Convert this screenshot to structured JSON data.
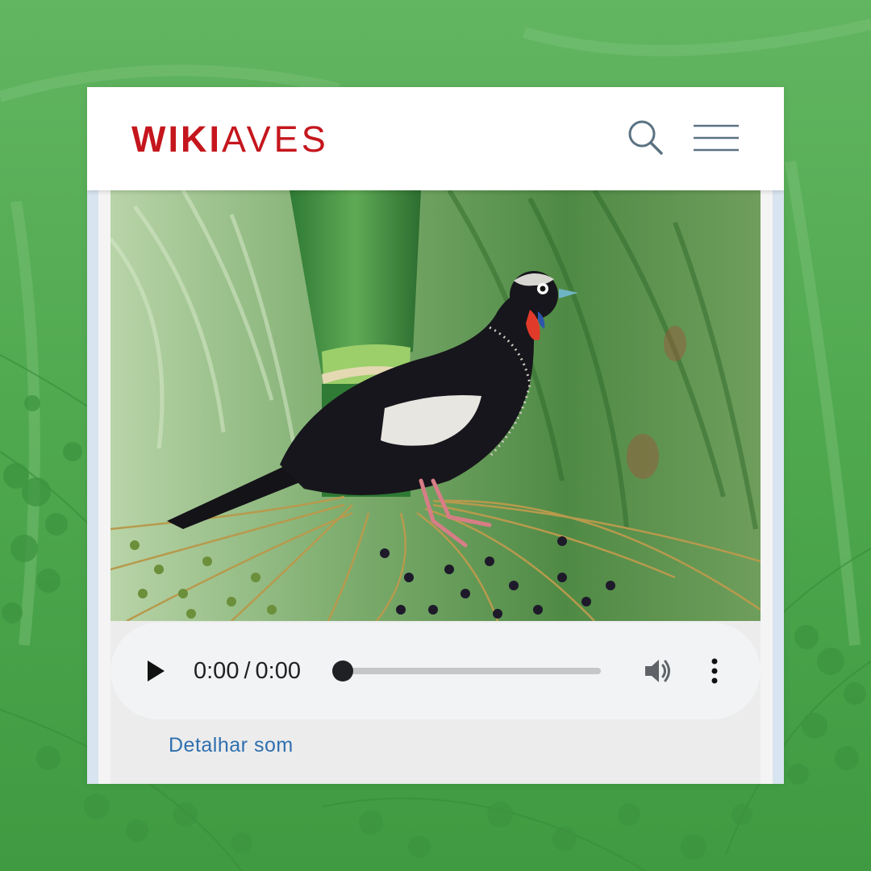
{
  "brand": {
    "logo_bold": "WIKI",
    "logo_light": "AVES",
    "color": "#c5161d"
  },
  "header": {
    "search_icon": "search-icon",
    "menu_icon": "hamburger-menu-icon"
  },
  "photo": {
    "subject": "bird-photo",
    "alt": "bird-photo"
  },
  "audio": {
    "current_time": "0:00",
    "separator": "/",
    "duration": "0:00",
    "progress": 0,
    "play_icon": "play-icon",
    "volume_icon": "volume-icon",
    "more_icon": "more-options-icon"
  },
  "links": {
    "detail_sound": "Detalhar som",
    "link_color": "#2e6fae"
  }
}
